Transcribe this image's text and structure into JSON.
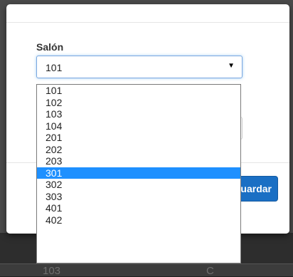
{
  "background_table": {
    "cell_a": "103",
    "cell_b": "C"
  },
  "modal": {
    "field_label": "Salón",
    "select_value": "101",
    "arrow_glyph": "▼",
    "save_button_label": "Guardar"
  },
  "dropdown": {
    "options": [
      "101",
      "102",
      "103",
      "104",
      "201",
      "202",
      "203",
      "301",
      "302",
      "303",
      "401",
      "402"
    ],
    "highlighted": "301"
  },
  "colors": {
    "highlight": "#1e90ff",
    "primary_button": "#1a6fc4"
  }
}
